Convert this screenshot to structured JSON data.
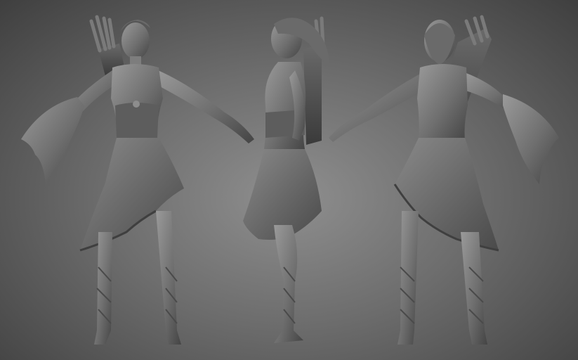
{
  "scene": {
    "background_center": "#8f8f8f",
    "background_edge": "#3f3f3f",
    "clay_light": "#9a9a9a",
    "clay_mid": "#6f6f6f",
    "clay_dark": "#3c3c3c"
  },
  "views": [
    {
      "name": "front"
    },
    {
      "name": "side"
    },
    {
      "name": "back"
    }
  ]
}
